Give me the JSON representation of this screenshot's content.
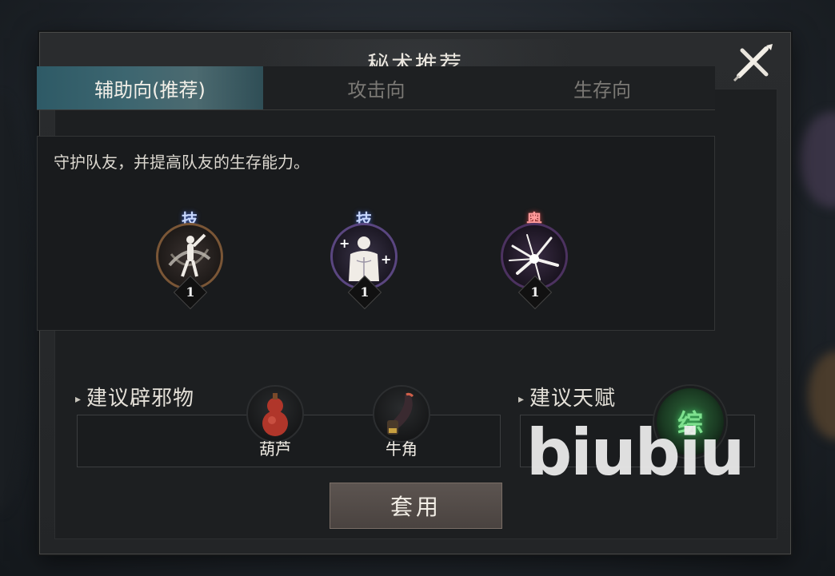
{
  "dialog": {
    "title": "秘术推荐",
    "close_icon": "close-x-icon"
  },
  "tabs": [
    {
      "label": "辅助向(推荐)",
      "active": true
    },
    {
      "label": "攻击向",
      "active": false
    },
    {
      "label": "生存向",
      "active": false
    }
  ],
  "description": "守护队友，并提高队友的生存能力。",
  "skills": [
    {
      "tag": "技",
      "level": "1",
      "icon": "warrior-spin-icon",
      "tag_color": "#c8d8ff",
      "ring_color": "#6a4a30"
    },
    {
      "tag": "技",
      "level": "1",
      "icon": "muscle-body-icon",
      "tag_color": "#c8d8ff",
      "ring_color": "#4a3a68"
    },
    {
      "tag": "奥",
      "level": "1",
      "icon": "burst-slash-icon",
      "tag_color": "#ff9a9a",
      "ring_color": "#4a2f5a"
    }
  ],
  "ward_items": {
    "label": "建议辟邪物",
    "items": [
      {
        "name": "葫芦",
        "icon": "gourd-icon"
      },
      {
        "name": "牛角",
        "icon": "ox-horn-icon"
      }
    ]
  },
  "talent": {
    "label": "建议天赋",
    "badge": "综",
    "badge_color": "#7ee08e"
  },
  "apply_button": "套用",
  "watermark": "biubiu"
}
